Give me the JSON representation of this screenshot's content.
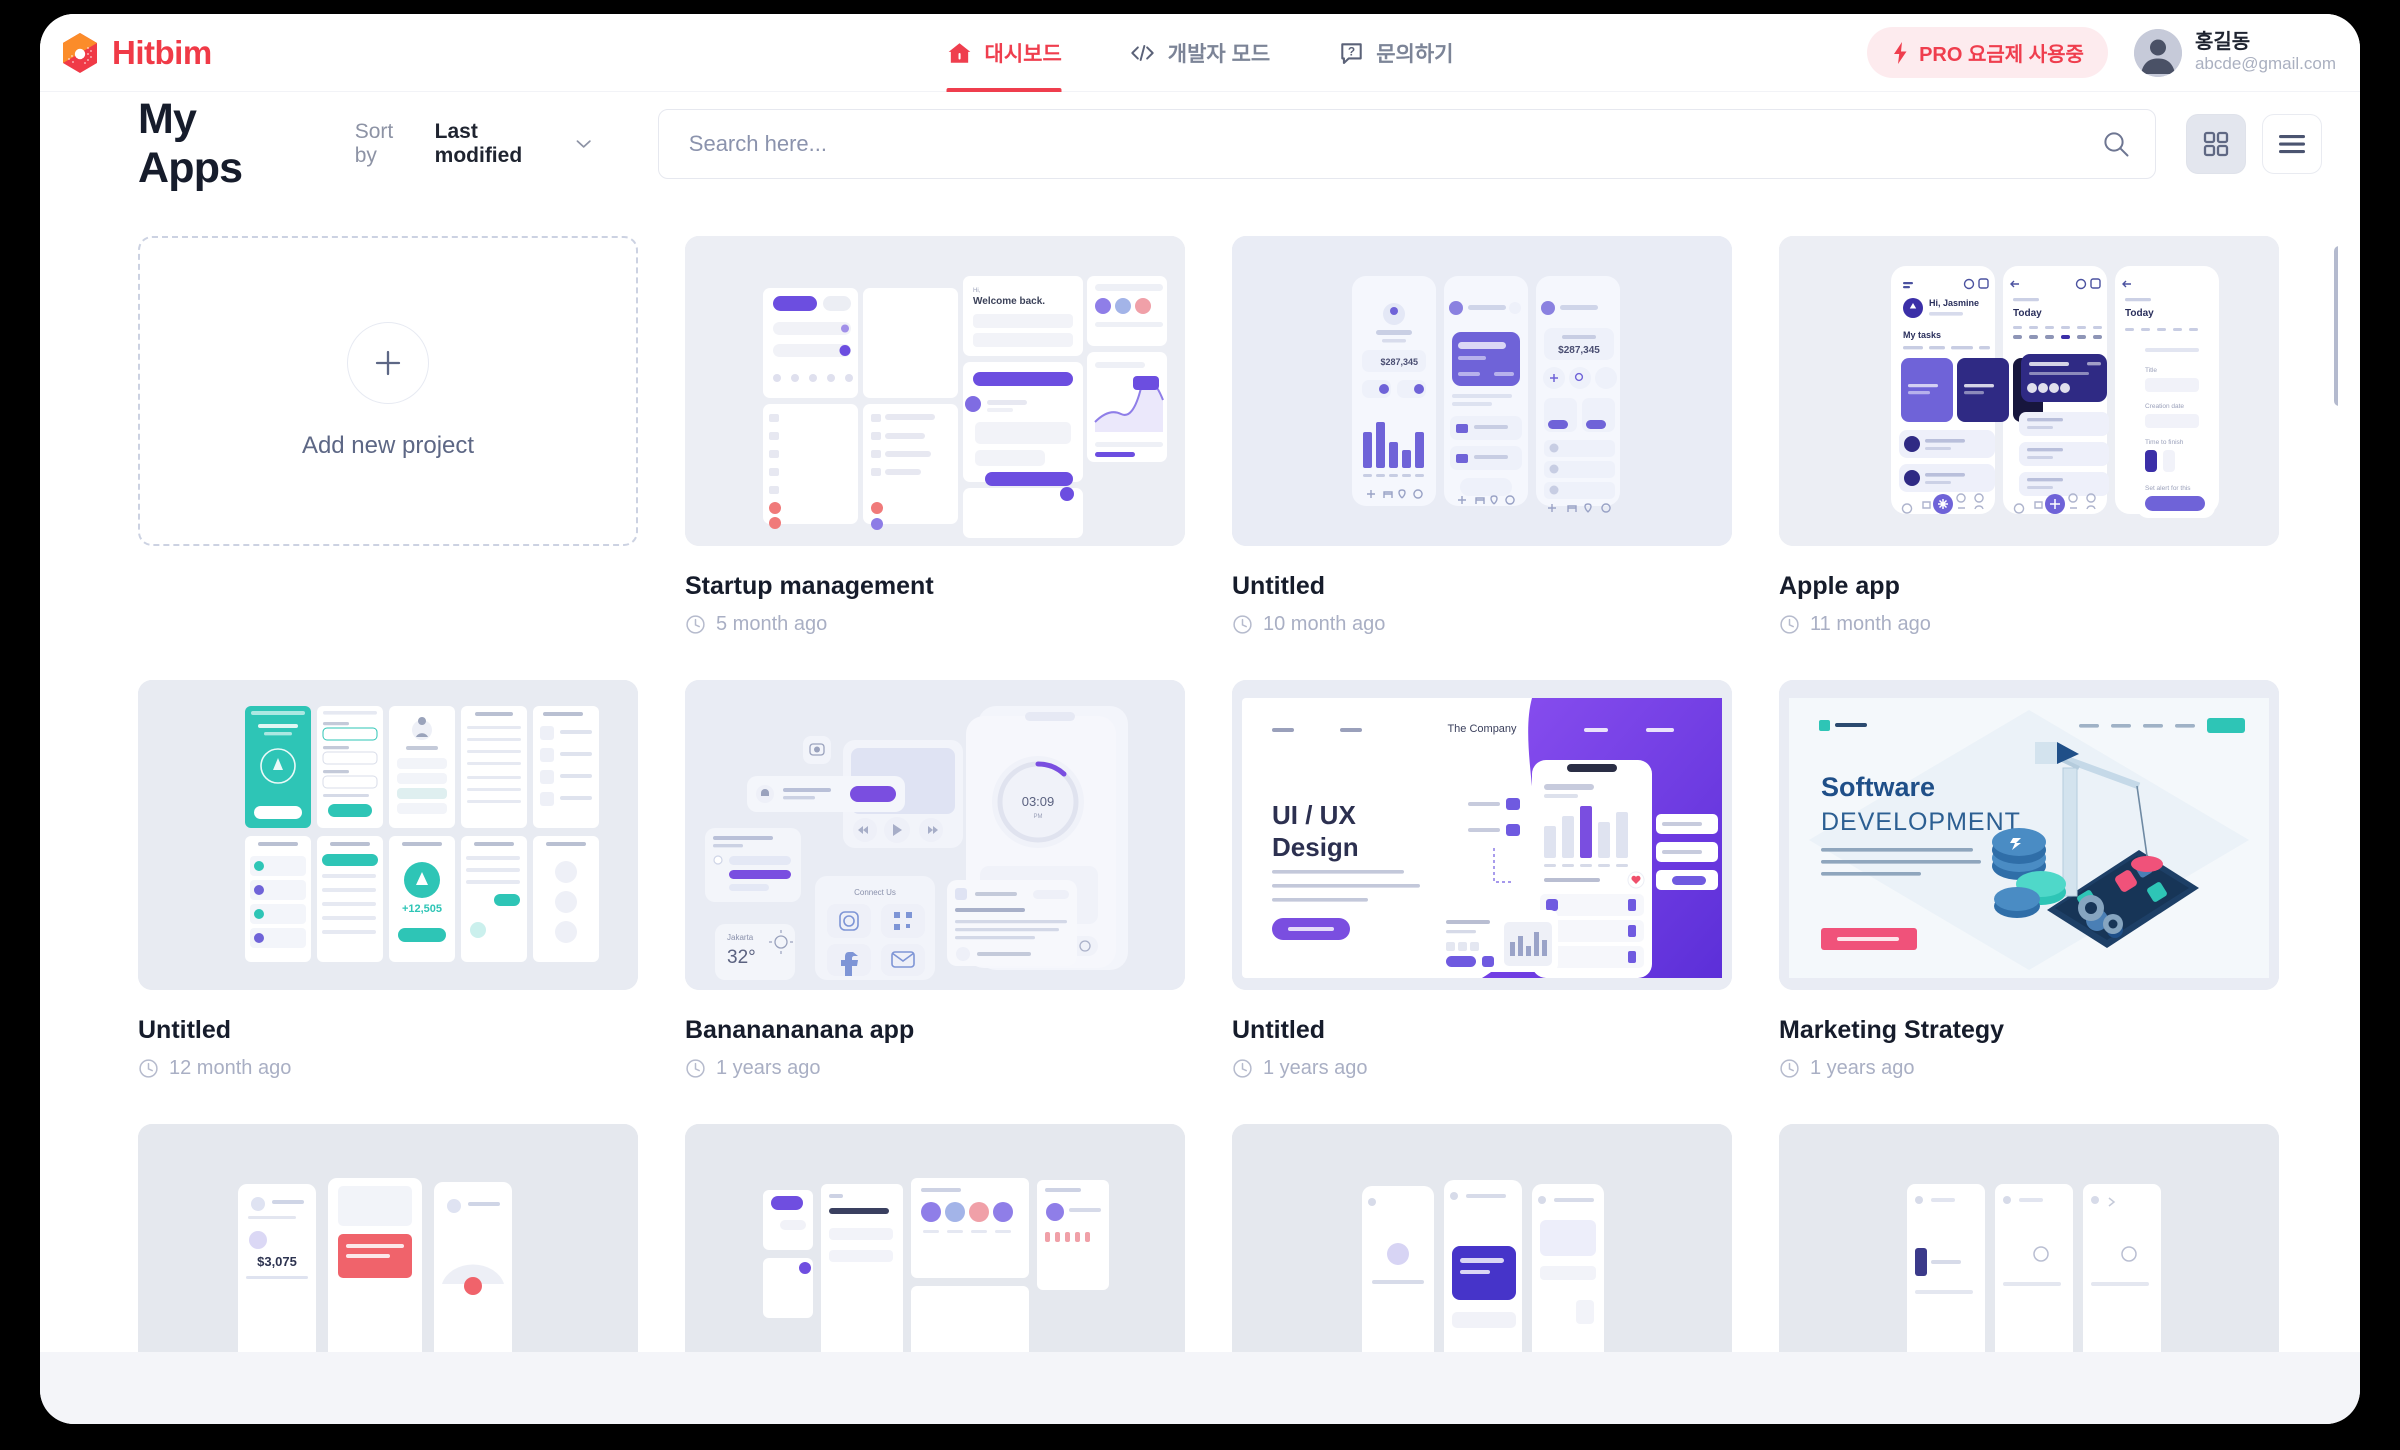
{
  "brand": {
    "name": "Hitbim",
    "logo_icon": "hitbim-hexagon-logo",
    "color": "#f03a47"
  },
  "nav": {
    "items": [
      {
        "label": "대시보드",
        "icon": "home-icon",
        "active": true
      },
      {
        "label": "개발자 모드",
        "icon": "code-icon",
        "active": false
      },
      {
        "label": "문의하기",
        "icon": "question-chat-icon",
        "active": false
      }
    ]
  },
  "account": {
    "pro_badge": {
      "label": "PRO 요금제 사용중",
      "icon": "bolt-icon",
      "color": "#ef3e4e",
      "bg": "#fdebee"
    },
    "user_name": "홍길동",
    "user_email": "abcde@gmail.com",
    "avatar_icon": "user-avatar"
  },
  "toolbar": {
    "title": "My Apps",
    "sort_label": "Sort by",
    "sort_value": "Last modified",
    "sort_options": [
      "Last modified"
    ],
    "chevron_icon": "chevron-down-icon",
    "search_placeholder": "Search here...",
    "search_value": "",
    "search_icon": "search-icon",
    "view_grid_icon": "grid-view-icon",
    "view_list_icon": "list-view-icon",
    "active_view": "grid"
  },
  "add_card": {
    "label": "Add new project",
    "icon": "plus-icon"
  },
  "projects": [
    {
      "title": "Startup management",
      "modified": "5 month ago",
      "clock_icon": "clock-icon",
      "thumb": "ui-kit-dashboard-purple"
    },
    {
      "title": "Untitled",
      "modified": "10 month ago",
      "clock_icon": "clock-icon",
      "thumb": "neumorphic-banking-app"
    },
    {
      "title": "Apple app",
      "modified": "11 month ago",
      "clock_icon": "clock-icon",
      "thumb": "indigo-task-app"
    },
    {
      "title": "Untitled",
      "modified": "12 month ago",
      "clock_icon": "clock-icon",
      "thumb": "teal-recycling-app-grid"
    },
    {
      "title": "Bananananana app",
      "modified": "1 years ago",
      "clock_icon": "clock-icon",
      "thumb": "neumorphic-widgets"
    },
    {
      "title": "Untitled",
      "modified": "1 years ago",
      "clock_icon": "clock-icon",
      "thumb": "uiux-design-landing"
    },
    {
      "title": "Marketing Strategy",
      "modified": "1 years ago",
      "clock_icon": "clock-icon",
      "thumb": "software-development-isometric"
    },
    {
      "title": "",
      "modified": "",
      "clock_icon": "clock-icon",
      "thumb": "row3-card-1"
    },
    {
      "title": "",
      "modified": "",
      "clock_icon": "clock-icon",
      "thumb": "row3-card-2"
    },
    {
      "title": "",
      "modified": "",
      "clock_icon": "clock-icon",
      "thumb": "row3-card-3"
    },
    {
      "title": "",
      "modified": "",
      "clock_icon": "clock-icon",
      "thumb": "row3-card-4"
    }
  ],
  "thumb_text": {
    "banking_balance": "$287,345",
    "weather_city": "Jakarta",
    "weather_temp": "32°",
    "timer": "03:09",
    "uiux_title_1": "UI / UX",
    "uiux_title_2": "Design",
    "uiux_company": "The Company",
    "software_title_1": "Software",
    "software_title_2": "DEVELOPMENT",
    "task_greeting": "Hi, Jasmine",
    "task_section": "My tasks",
    "task_today": "Today"
  },
  "colors": {
    "accent_red": "#ef3e4e",
    "thumb_bg": "#e5e8ee",
    "purple": "#6c4ee0",
    "indigo": "#3b2fa8",
    "teal": "#2ec5b6"
  }
}
